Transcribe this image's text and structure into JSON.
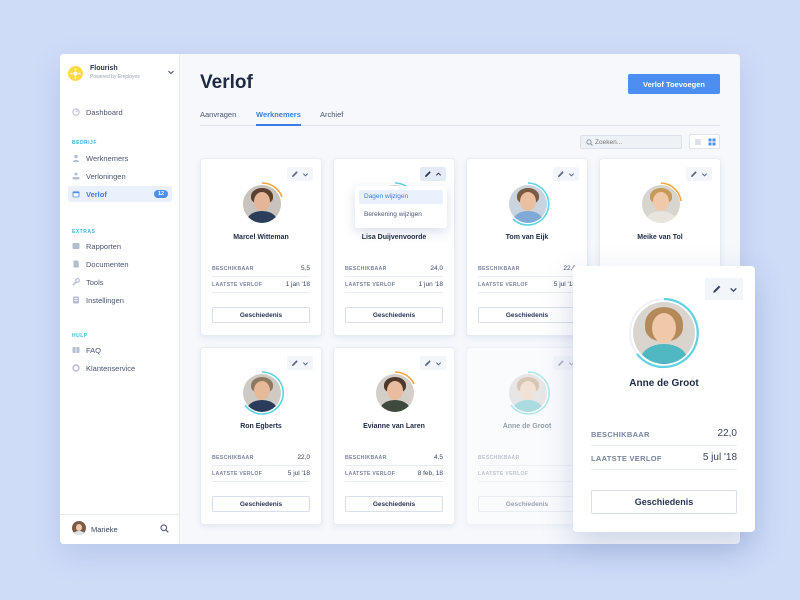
{
  "brand": {
    "name": "Flourish",
    "subtitle": "Powered by Employes"
  },
  "nav": {
    "dashboard": "Dashboard",
    "section_bedrijf": "BEDRIJF",
    "werknemers": "Werknemers",
    "verloningen": "Verloningen",
    "verlof": "Verlof",
    "verlof_badge": "12",
    "section_extras": "EXTRAS",
    "rapporten": "Rapporten",
    "documenten": "Documenten",
    "tools": "Tools",
    "instellingen": "Instellingen",
    "section_hulp": "HULP",
    "faq": "FAQ",
    "klantenservice": "Klantenservice"
  },
  "user": {
    "name": "Marieke"
  },
  "page": {
    "title": "Verlof",
    "add_button": "Verlof Toevoegen"
  },
  "tabs": [
    "Aanvragen",
    "Werknemers",
    "Archief"
  ],
  "search": {
    "placeholder": "Zoeken..."
  },
  "labels": {
    "available": "BESCHIKBAAR",
    "last_leave": "LAATSTE VERLOF",
    "history": "Geschiedenis"
  },
  "dropdown": {
    "item1": "Dagen wijzigen",
    "item2": "Berekening wijzigen"
  },
  "employees": [
    {
      "name": "Marcel Witteman",
      "available": "5,5",
      "last_leave": "1 jan '18",
      "ring": "#f7a43a"
    },
    {
      "name": "Lisa Duijvenvoorde",
      "available": "24,0",
      "last_leave": "1 jun '18",
      "ring": "#5fd3e0"
    },
    {
      "name": "Tom van Eijk",
      "available": "22,0",
      "last_leave": "5 jul '18",
      "ring": "#5fd3e0"
    },
    {
      "name": "Meike van Tol",
      "available": "",
      "last_leave": "",
      "ring": "#f7a43a"
    },
    {
      "name": "Ron Egberts",
      "available": "22,0",
      "last_leave": "5 jul '18",
      "ring": "#5fd3e0"
    },
    {
      "name": "Evianne van Laren",
      "available": "4,5",
      "last_leave": "8 feb, 18",
      "ring": "#f7a43a"
    },
    {
      "name": "Anne de Groot",
      "available": "",
      "last_leave": "",
      "ring": "#5fd3e0"
    }
  ],
  "detail": {
    "name": "Anne de Groot",
    "available": "22,0",
    "last_leave": "5 jul '18"
  },
  "colors": {
    "accent": "#4d8ff0",
    "teal": "#3fb3d7",
    "orange_ring": "#f7a43a",
    "teal_ring": "#5fd3e0"
  }
}
